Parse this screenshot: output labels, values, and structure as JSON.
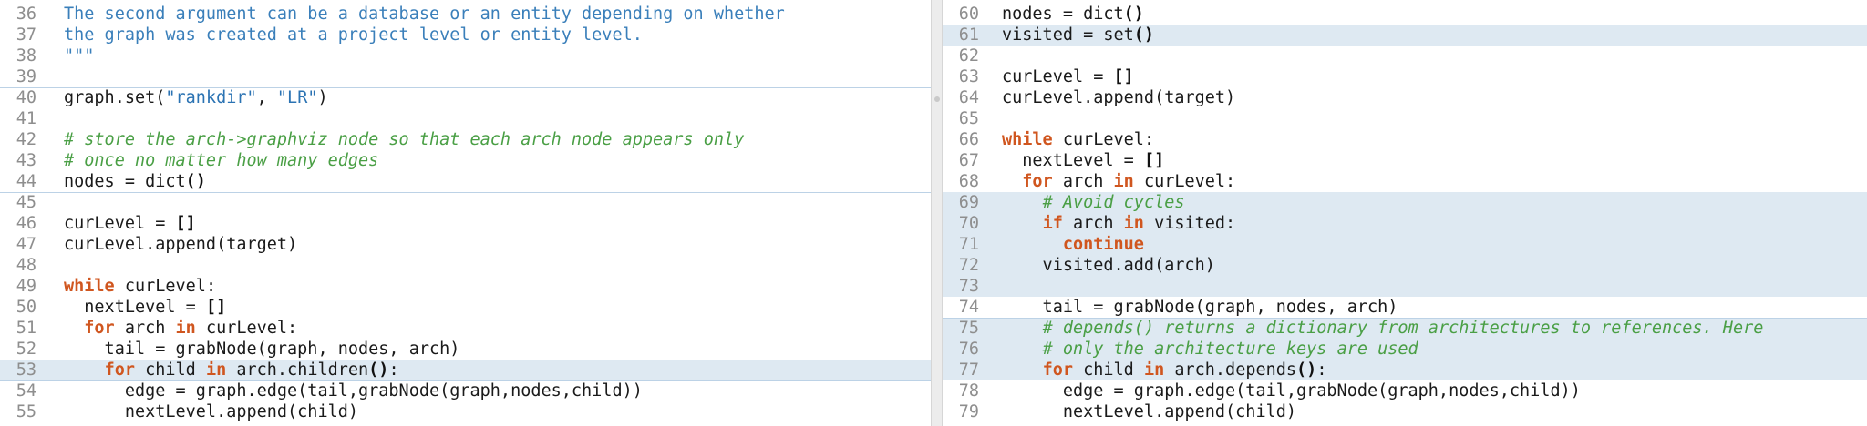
{
  "left_pane": {
    "lines": [
      {
        "num": "36",
        "hl": false,
        "tokens": [
          {
            "t": "doc",
            "v": "The second argument can be a database or an entity depending on whether"
          }
        ]
      },
      {
        "num": "37",
        "hl": false,
        "tokens": [
          {
            "t": "doc",
            "v": "the graph was created at a project level or entity level."
          }
        ]
      },
      {
        "num": "38",
        "hl": false,
        "tokens": [
          {
            "t": "doc",
            "v": "\"\"\""
          }
        ]
      },
      {
        "num": "39",
        "hl": false,
        "tokens": []
      },
      {
        "num": "40",
        "hl": false,
        "tokens": [
          {
            "t": "plain",
            "v": "graph.set("
          },
          {
            "t": "str",
            "v": "\"rankdir\""
          },
          {
            "t": "plain",
            "v": ", "
          },
          {
            "t": "str",
            "v": "\"LR\""
          },
          {
            "t": "plain",
            "v": ")"
          }
        ]
      },
      {
        "num": "41",
        "hl": false,
        "tokens": []
      },
      {
        "num": "42",
        "hl": false,
        "tokens": [
          {
            "t": "com",
            "v": "# store the arch->graphviz node so that each arch node appears only"
          }
        ]
      },
      {
        "num": "43",
        "hl": false,
        "tokens": [
          {
            "t": "com",
            "v": "# once no matter how many edges"
          }
        ]
      },
      {
        "num": "44",
        "hl": false,
        "tokens": [
          {
            "t": "plain",
            "v": "nodes = dict"
          },
          {
            "t": "b",
            "v": "()"
          }
        ]
      },
      {
        "num": "45",
        "hl": false,
        "tokens": []
      },
      {
        "num": "46",
        "hl": false,
        "tokens": [
          {
            "t": "plain",
            "v": "curLevel = "
          },
          {
            "t": "b",
            "v": "[]"
          }
        ]
      },
      {
        "num": "47",
        "hl": false,
        "tokens": [
          {
            "t": "plain",
            "v": "curLevel.append(target)"
          }
        ]
      },
      {
        "num": "48",
        "hl": false,
        "tokens": []
      },
      {
        "num": "49",
        "hl": false,
        "tokens": [
          {
            "t": "kw",
            "v": "while"
          },
          {
            "t": "plain",
            "v": " curLevel:"
          }
        ]
      },
      {
        "num": "50",
        "hl": false,
        "tokens": [
          {
            "t": "plain",
            "v": "  nextLevel = "
          },
          {
            "t": "b",
            "v": "[]"
          }
        ]
      },
      {
        "num": "51",
        "hl": false,
        "tokens": [
          {
            "t": "plain",
            "v": "  "
          },
          {
            "t": "kw",
            "v": "for"
          },
          {
            "t": "plain",
            "v": " arch "
          },
          {
            "t": "kw",
            "v": "in"
          },
          {
            "t": "plain",
            "v": " curLevel:"
          }
        ]
      },
      {
        "num": "52",
        "hl": false,
        "tokens": [
          {
            "t": "plain",
            "v": "    tail = grabNode(graph, nodes, arch)"
          }
        ]
      },
      {
        "num": "53",
        "hl": true,
        "tokens": [
          {
            "t": "plain",
            "v": "    "
          },
          {
            "t": "kw",
            "v": "for"
          },
          {
            "t": "plain",
            "v": " child "
          },
          {
            "t": "kw",
            "v": "in"
          },
          {
            "t": "plain",
            "v": " arch.children"
          },
          {
            "t": "b",
            "v": "()"
          },
          {
            "t": "plain",
            "v": ":"
          }
        ]
      },
      {
        "num": "54",
        "hl": false,
        "tokens": [
          {
            "t": "plain",
            "v": "      edge = graph.edge(tail,grabNode(graph,nodes,child))"
          }
        ]
      },
      {
        "num": "55",
        "hl": false,
        "tokens": [
          {
            "t": "plain",
            "v": "      nextLevel.append(child)"
          }
        ]
      }
    ]
  },
  "right_pane": {
    "lines": [
      {
        "num": "60",
        "hl": false,
        "tokens": [
          {
            "t": "plain",
            "v": "nodes = dict"
          },
          {
            "t": "b",
            "v": "()"
          }
        ]
      },
      {
        "num": "61",
        "hl": true,
        "tokens": [
          {
            "t": "plain",
            "v": "visited = set"
          },
          {
            "t": "b",
            "v": "()"
          }
        ]
      },
      {
        "num": "62",
        "hl": false,
        "tokens": []
      },
      {
        "num": "63",
        "hl": false,
        "tokens": [
          {
            "t": "plain",
            "v": "curLevel = "
          },
          {
            "t": "b",
            "v": "[]"
          }
        ]
      },
      {
        "num": "64",
        "hl": false,
        "tokens": [
          {
            "t": "plain",
            "v": "curLevel.append(target)"
          }
        ]
      },
      {
        "num": "65",
        "hl": false,
        "tokens": []
      },
      {
        "num": "66",
        "hl": false,
        "tokens": [
          {
            "t": "kw",
            "v": "while"
          },
          {
            "t": "plain",
            "v": " curLevel:"
          }
        ]
      },
      {
        "num": "67",
        "hl": false,
        "tokens": [
          {
            "t": "plain",
            "v": "  nextLevel = "
          },
          {
            "t": "b",
            "v": "[]"
          }
        ]
      },
      {
        "num": "68",
        "hl": false,
        "tokens": [
          {
            "t": "plain",
            "v": "  "
          },
          {
            "t": "kw",
            "v": "for"
          },
          {
            "t": "plain",
            "v": " arch "
          },
          {
            "t": "kw",
            "v": "in"
          },
          {
            "t": "plain",
            "v": " curLevel:"
          }
        ]
      },
      {
        "num": "69",
        "hl": true,
        "tokens": [
          {
            "t": "plain",
            "v": "    "
          },
          {
            "t": "com",
            "v": "# Avoid cycles"
          }
        ]
      },
      {
        "num": "70",
        "hl": true,
        "tokens": [
          {
            "t": "plain",
            "v": "    "
          },
          {
            "t": "kw",
            "v": "if"
          },
          {
            "t": "plain",
            "v": " arch "
          },
          {
            "t": "kw",
            "v": "in"
          },
          {
            "t": "plain",
            "v": " visited:"
          }
        ]
      },
      {
        "num": "71",
        "hl": true,
        "tokens": [
          {
            "t": "plain",
            "v": "      "
          },
          {
            "t": "kw",
            "v": "continue"
          }
        ]
      },
      {
        "num": "72",
        "hl": true,
        "tokens": [
          {
            "t": "plain",
            "v": "    visited.add(arch)"
          }
        ]
      },
      {
        "num": "73",
        "hl": true,
        "tokens": []
      },
      {
        "num": "74",
        "hl": false,
        "tokens": [
          {
            "t": "plain",
            "v": "    tail = grabNode(graph, nodes, arch)"
          }
        ]
      },
      {
        "num": "75",
        "hl": true,
        "tokens": [
          {
            "t": "plain",
            "v": "    "
          },
          {
            "t": "com",
            "v": "# depends() returns a dictionary from architectures to references. Here"
          }
        ]
      },
      {
        "num": "76",
        "hl": true,
        "tokens": [
          {
            "t": "plain",
            "v": "    "
          },
          {
            "t": "com",
            "v": "# only the architecture keys are used"
          }
        ]
      },
      {
        "num": "77",
        "hl": true,
        "tokens": [
          {
            "t": "plain",
            "v": "    "
          },
          {
            "t": "kw",
            "v": "for"
          },
          {
            "t": "plain",
            "v": " child "
          },
          {
            "t": "kw",
            "v": "in"
          },
          {
            "t": "plain",
            "v": " arch.depends"
          },
          {
            "t": "b",
            "v": "()"
          },
          {
            "t": "plain",
            "v": ":"
          }
        ]
      },
      {
        "num": "78",
        "hl": false,
        "tokens": [
          {
            "t": "plain",
            "v": "      edge = graph.edge(tail,grabNode(graph,nodes,child))"
          }
        ]
      },
      {
        "num": "79",
        "hl": false,
        "tokens": [
          {
            "t": "plain",
            "v": "      nextLevel.append(child)"
          }
        ]
      }
    ]
  },
  "colors": {
    "keyword": "#d0561f",
    "string": "#2b73b3",
    "docstring": "#3a7fba",
    "comment": "#4a9f45",
    "change_highlight": "#dee9f2"
  },
  "icons": {
    "divider_handle": "drag-handle-icon"
  }
}
